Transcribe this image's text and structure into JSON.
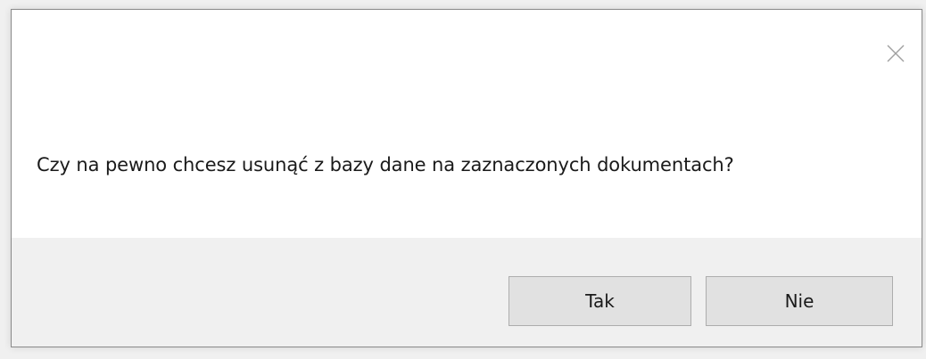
{
  "dialog": {
    "message": "Czy na pewno chcesz usunąć z bazy dane na zaznaczonych dokumentach?",
    "close_icon": "close-icon",
    "buttons": {
      "yes_label": "Tak",
      "no_label": "Nie"
    }
  },
  "colors": {
    "content_background": "#ffffff",
    "footer_background": "#f0f0f0",
    "button_background": "#e1e1e1",
    "button_border": "#adadad",
    "text": "#1a1a1a"
  }
}
